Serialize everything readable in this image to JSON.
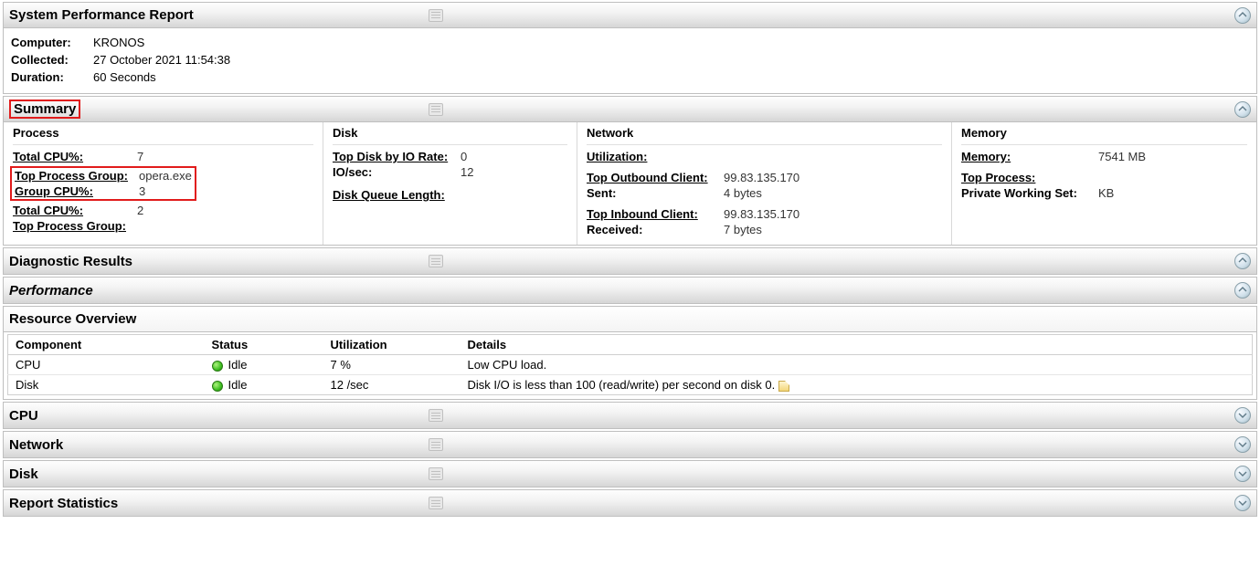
{
  "header": {
    "title": "System Performance Report",
    "computer_label": "Computer:",
    "computer": "KRONOS",
    "collected_label": "Collected:",
    "collected": "27 October 2021 11:54:38",
    "duration_label": "Duration:",
    "duration": "60 Seconds"
  },
  "summary": {
    "title": "Summary",
    "process": {
      "heading": "Process",
      "total_cpu_label": "Total CPU%:",
      "total_cpu_val": "7",
      "top_group_label": "Top Process Group:",
      "top_group_val": "opera.exe",
      "group_cpu_label": "Group CPU%:",
      "group_cpu_val": "3",
      "total_cpu2_label": "Total CPU%:",
      "total_cpu2_val": "2",
      "top_group2_label": "Top Process Group:"
    },
    "disk": {
      "heading": "Disk",
      "top_disk_label": "Top Disk by IO Rate:",
      "top_disk_val": "0",
      "io_sec_label": "IO/sec:",
      "io_sec_val": "12",
      "queue_label": "Disk Queue Length:"
    },
    "network": {
      "heading": "Network",
      "utilization_label": "Utilization:",
      "top_out_label": "Top Outbound Client:",
      "top_out_val": "99.83.135.170",
      "sent_label": "Sent:",
      "sent_val": "4 bytes",
      "top_in_label": "Top Inbound Client:",
      "top_in_val": "99.83.135.170",
      "received_label": "Received:",
      "received_val": "7 bytes"
    },
    "memory": {
      "heading": "Memory",
      "memory_label": "Memory:",
      "memory_val": "7541 MB",
      "top_process_label": "Top Process:",
      "pws_label": "Private Working Set:",
      "pws_val": "KB"
    }
  },
  "diagnostic": {
    "title": "Diagnostic Results"
  },
  "performance": {
    "title": "Performance"
  },
  "resource_overview": {
    "title": "Resource Overview",
    "columns": {
      "component": "Component",
      "status": "Status",
      "utilization": "Utilization",
      "details": "Details"
    },
    "rows": [
      {
        "component": "CPU",
        "status": "Idle",
        "utilization": "7 %",
        "details": "Low CPU load."
      },
      {
        "component": "Disk",
        "status": "Idle",
        "utilization": "12 /sec",
        "details": "Disk I/O is less than 100 (read/write) per second on disk 0."
      }
    ]
  },
  "cpu_section": {
    "title": "CPU"
  },
  "network_section": {
    "title": "Network"
  },
  "disk_section": {
    "title": "Disk"
  },
  "stats_section": {
    "title": "Report Statistics"
  }
}
